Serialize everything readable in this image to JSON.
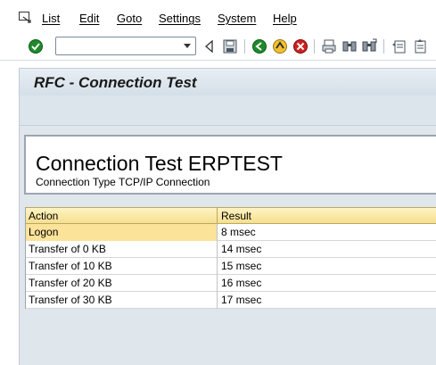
{
  "menu": {
    "items": [
      "List",
      "Edit",
      "Goto",
      "Settings",
      "System",
      "Help"
    ]
  },
  "toolbar": {
    "command_value": "",
    "buttons": [
      "enter-icon",
      "back-triangle-icon",
      "save-icon",
      "back-icon",
      "exit-icon",
      "cancel-icon",
      "print-icon",
      "find-icon",
      "find-next-icon",
      "first-page-icon",
      "previous-page-icon"
    ]
  },
  "page": {
    "title": "RFC - Connection Test",
    "heading": "Connection Test ERPTEST",
    "subheading": "Connection Type TCP/IP Connection"
  },
  "table": {
    "columns": [
      "Action",
      "Result"
    ],
    "rows": [
      {
        "action": "Logon",
        "result": "8 msec"
      },
      {
        "action": "Transfer of 0 KB",
        "result": "14 msec"
      },
      {
        "action": "Transfer of 10 KB",
        "result": "15 msec"
      },
      {
        "action": "Transfer of 20 KB",
        "result": "16 msec"
      },
      {
        "action": "Transfer of 30 KB",
        "result": "17 msec"
      }
    ],
    "selected_row": 0
  },
  "colors": {
    "accent_green": "#1f8a2c",
    "exit_yellow": "#f2c12e",
    "cancel_red": "#d02020",
    "header_yellow": "#f6df8f",
    "panel_blue": "#dfe6ec"
  }
}
